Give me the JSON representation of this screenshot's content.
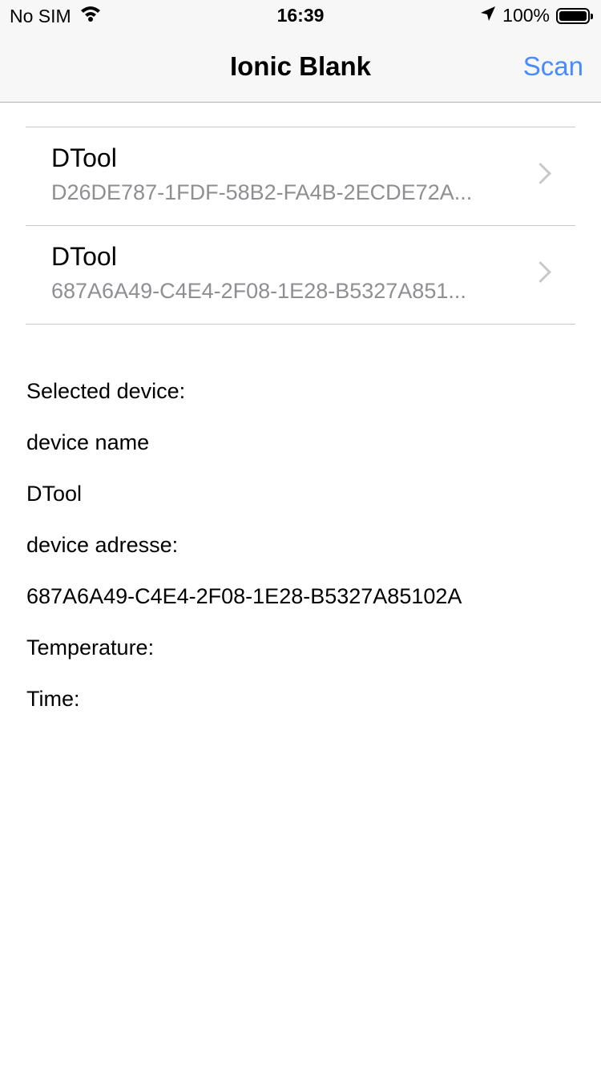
{
  "status": {
    "carrier": "No SIM",
    "time": "16:39",
    "battery": "100%",
    "battery_level": 1.0
  },
  "nav": {
    "title": "Ionic Blank",
    "scan_label": "Scan"
  },
  "devices": [
    {
      "name": "DTool",
      "address": "D26DE787-1FDF-58B2-FA4B-2ECDE72A..."
    },
    {
      "name": "DTool",
      "address": "687A6A49-C4E4-2F08-1E28-B5327A851..."
    }
  ],
  "details": {
    "selected_label": "Selected device:",
    "name_label": "device name",
    "name_value": "DTool",
    "address_label": "device adresse:",
    "address_value": "687A6A49-C4E4-2F08-1E28-B5327A85102A",
    "temperature_label": "Temperature:",
    "time_label": "Time:"
  }
}
